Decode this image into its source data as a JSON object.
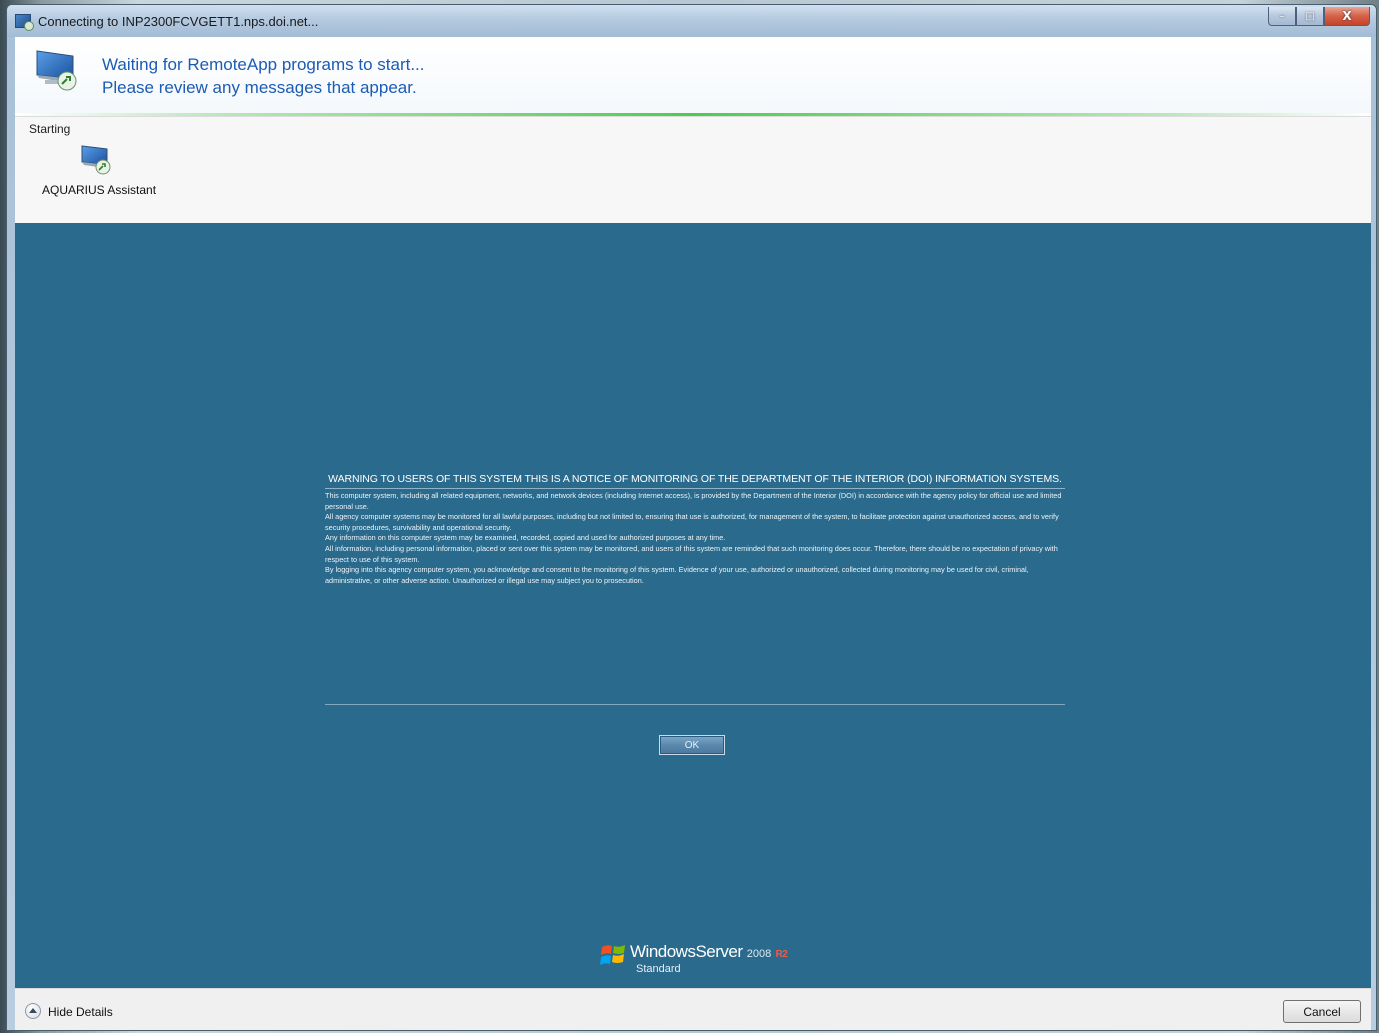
{
  "window": {
    "title": "Connecting to INP2300FCVGETT1.nps.doi.net...",
    "caption_minimize": "–",
    "caption_maximize": "□",
    "caption_close": "X"
  },
  "header": {
    "line1": "Waiting for RemoteApp programs to start...",
    "line2": "Please review any messages that appear.",
    "icon": "remoteapp-monitor-icon"
  },
  "details": {
    "section_label": "Starting",
    "apps": [
      {
        "label": "AQUARIUS Assistant",
        "icon": "remoteapp-monitor-icon"
      }
    ]
  },
  "remote_session": {
    "background_color": "#2a6a8c",
    "notice_title": "WARNING TO USERS OF THIS SYSTEM THIS IS A NOTICE OF MONITORING OF THE DEPARTMENT OF THE INTERIOR (DOI) INFORMATION SYSTEMS.",
    "notice_paragraphs": [
      "This computer system, including all related equipment, networks, and network devices (including Internet access), is provided by the Department of the Interior (DOI) in accordance with the agency policy for official use and limited personal use.",
      "All agency computer systems may be monitored for all lawful purposes, including but not limited to, ensuring that use is authorized, for management of the system, to facilitate protection against unauthorized access, and to verify security procedures, survivability and operational security.",
      "Any information on this computer system may be examined, recorded, copied and used for authorized purposes at any time.",
      "All information, including personal information, placed or sent over this system may be monitored, and users of this system are reminded that such monitoring does occur. Therefore, there should be no expectation of privacy with respect to use of this system.",
      "By logging into this agency computer system, you acknowledge and consent to the monitoring of this system. Evidence of your use, authorized or unauthorized, collected during monitoring may be used for civil, criminal, administrative, or other adverse action. Unauthorized or illegal use may subject you to prosecution."
    ],
    "ok_label": "OK",
    "branding": {
      "product": "WindowsServer",
      "version": "2008",
      "release": "R2",
      "edition": "Standard"
    }
  },
  "footer": {
    "hide_details_label": "Hide Details",
    "cancel_label": "Cancel"
  }
}
